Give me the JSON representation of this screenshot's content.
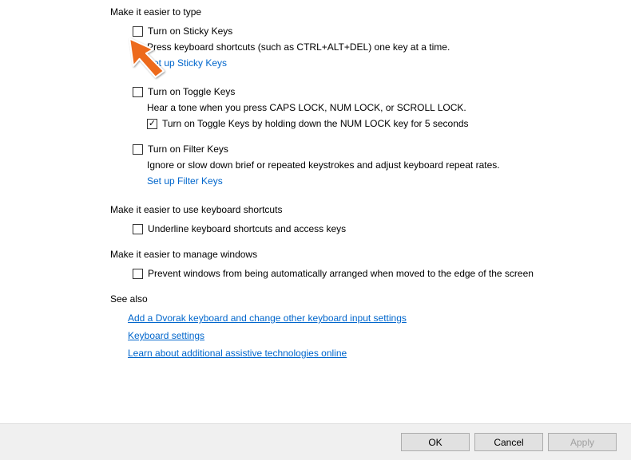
{
  "sections": {
    "type": {
      "title": "Make it easier to type",
      "sticky": {
        "label": "Turn on Sticky Keys",
        "description": "Press keyboard shortcuts (such as CTRL+ALT+DEL) one key at a time.",
        "link": "Set up Sticky Keys"
      },
      "toggle": {
        "label": "Turn on Toggle Keys",
        "description": "Hear a tone when you press CAPS LOCK, NUM LOCK, or SCROLL LOCK.",
        "sub_label": "Turn on Toggle Keys by holding down the NUM LOCK key for 5 seconds"
      },
      "filter": {
        "label": "Turn on Filter Keys",
        "description": "Ignore or slow down brief or repeated keystrokes and adjust keyboard repeat rates.",
        "link": "Set up Filter Keys"
      }
    },
    "shortcuts": {
      "title": "Make it easier to use keyboard shortcuts",
      "underline": {
        "label": "Underline keyboard shortcuts and access keys"
      }
    },
    "windows": {
      "title": "Make it easier to manage windows",
      "prevent": {
        "label": "Prevent windows from being automatically arranged when moved to the edge of the screen"
      }
    },
    "see_also": {
      "title": "See also",
      "links": {
        "dvorak": "Add a Dvorak keyboard and change other keyboard input settings",
        "keyboard": "Keyboard settings",
        "assistive": "Learn about additional assistive technologies online"
      }
    }
  },
  "buttons": {
    "ok": "OK",
    "cancel": "Cancel",
    "apply": "Apply"
  }
}
